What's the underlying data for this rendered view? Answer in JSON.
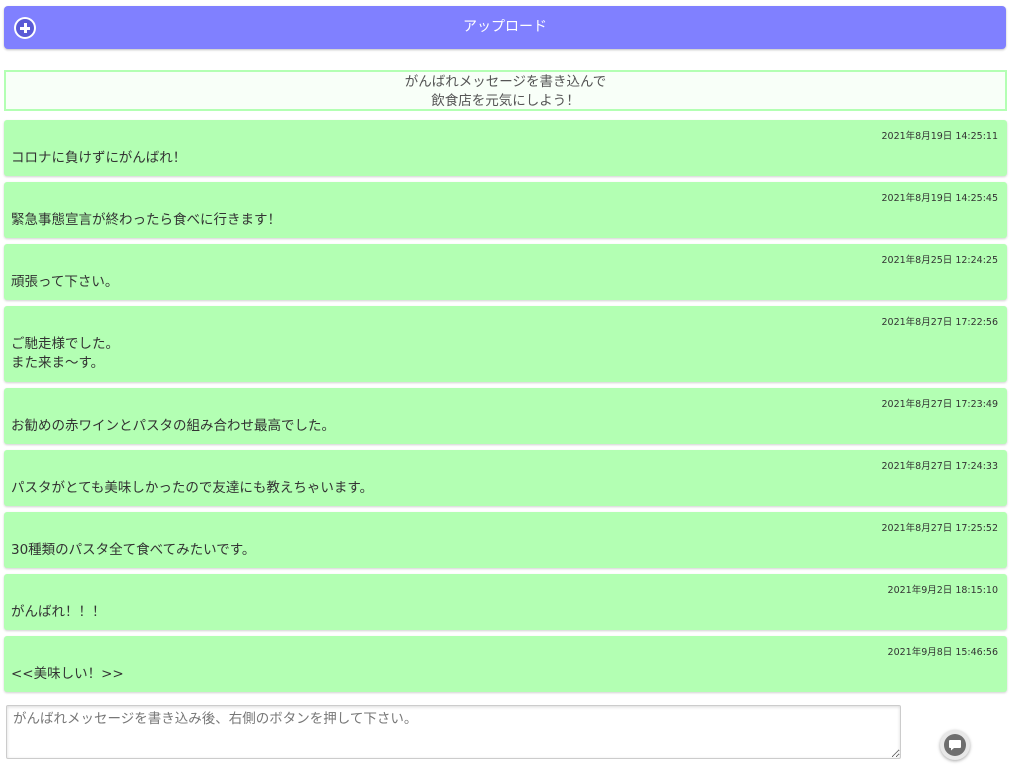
{
  "upload": {
    "label": "アップロード",
    "icon": "plus-circle-icon",
    "color": "#8080ff"
  },
  "banner": {
    "line1": "がんばれメッセージを書き込んで",
    "line2": "飲食店を元気にしよう！",
    "border_color": "#b3ffb3"
  },
  "messages": [
    {
      "time": "2021年8月19日 14:25:11",
      "text": "コロナに負けずにがんばれ！"
    },
    {
      "time": "2021年8月19日 14:25:45",
      "text": "緊急事態宣言が終わったら食べに行きます！"
    },
    {
      "time": "2021年8月25日 12:24:25",
      "text": "頑張って下さい。"
    },
    {
      "time": "2021年8月27日 17:22:56",
      "text": "ご馳走様でした。\nまた来ま～す。"
    },
    {
      "time": "2021年8月27日 17:23:49",
      "text": "お勧めの赤ワインとパスタの組み合わせ最高でした。"
    },
    {
      "time": "2021年8月27日 17:24:33",
      "text": "パスタがとても美味しかったので友達にも教えちゃいます。"
    },
    {
      "time": "2021年8月27日 17:25:52",
      "text": "30種類のパスタ全て食べてみたいです。"
    },
    {
      "time": "2021年9月2日 18:15:10",
      "text": "がんばれ！！！"
    },
    {
      "time": "2021年9月8日 15:46:56",
      "text": "<<美味しい！>>"
    }
  ],
  "message_color": "#b3ffb3",
  "compose": {
    "placeholder": "がんばれメッセージを書き込み後、右側のボタンを押して下さい。",
    "value": ""
  },
  "send": {
    "icon": "chat-bubble-icon"
  }
}
